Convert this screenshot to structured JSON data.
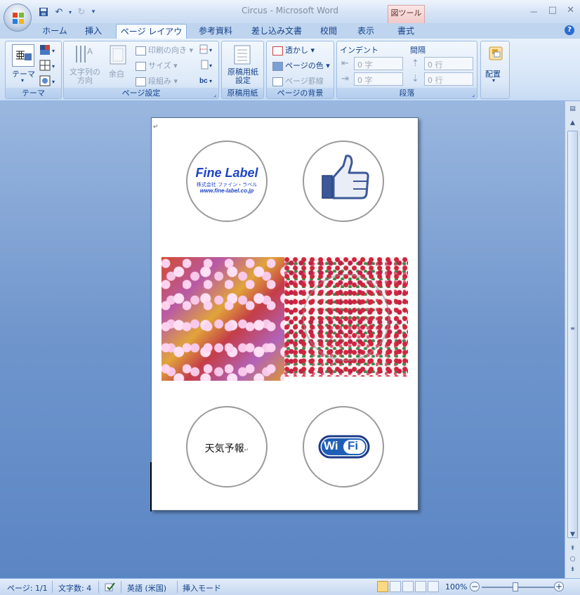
{
  "window": {
    "title": "Circus - Microsoft Word",
    "context_tool_label": "図ツール",
    "minimize": "－",
    "maximize": "□",
    "close": "✕"
  },
  "tabs": [
    {
      "label": "ホーム",
      "active": false
    },
    {
      "label": "挿入",
      "active": false
    },
    {
      "label": "ページ レイアウト",
      "active": true
    },
    {
      "label": "参考資料",
      "active": false
    },
    {
      "label": "差し込み文書",
      "active": false
    },
    {
      "label": "校閲",
      "active": false
    },
    {
      "label": "表示",
      "active": false
    },
    {
      "label": "書式",
      "active": false
    }
  ],
  "ribbon": {
    "theme": {
      "label": "テーマ",
      "group": "テーマ"
    },
    "page_setup": {
      "text_direction": "文字列の方向",
      "margins": "余白",
      "orientation": "印刷の向き",
      "size": "サイズ",
      "columns": "段組み",
      "group": "ページ設定"
    },
    "manuscript": {
      "button": "原稿用紙設定",
      "group": "原稿用紙"
    },
    "background": {
      "watermark": "透かし",
      "page_color": "ページの色",
      "page_borders": "ページ罫線",
      "group": "ページの背景"
    },
    "paragraph": {
      "indent_label": "インデント",
      "spacing_label": "間隔",
      "indent_left": "0 字",
      "indent_right": "0 字",
      "spacing_before": "0 行",
      "spacing_after": "0 行",
      "group": "段落"
    },
    "arrange": {
      "button": "配置"
    }
  },
  "document": {
    "fine_label_title": "Fine Label",
    "fine_label_sub": "株式会社 ファイン・ラベル",
    "fine_label_url": "www.fine-label.co.jp",
    "weather_text": "天気予報",
    "wifi_left": "Wi",
    "wifi_right": "Fi"
  },
  "status": {
    "page": "ページ: 1/1",
    "word_count": "文字数: 4",
    "language": "英語 (米国)",
    "mode": "挿入モード",
    "zoom": "100%",
    "zoom_level_percent": 100
  }
}
